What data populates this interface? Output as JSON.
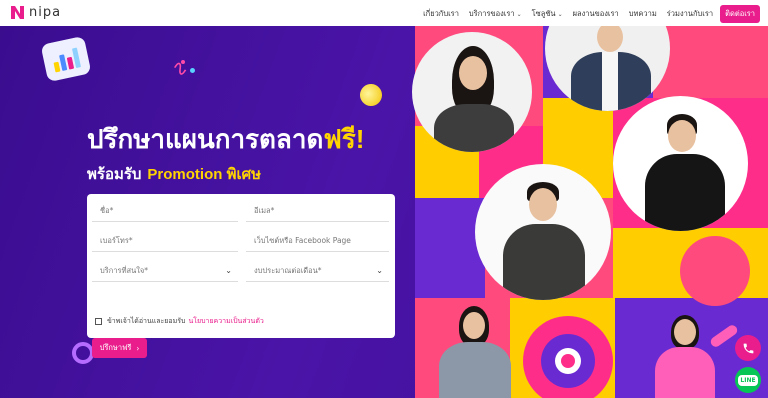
{
  "nav": {
    "logo_text": "nipa",
    "items": [
      {
        "label": "เกี่ยวกับเรา",
        "dropdown": false
      },
      {
        "label": "บริการของเรา",
        "dropdown": true
      },
      {
        "label": "โซลูชัน",
        "dropdown": true
      },
      {
        "label": "ผลงานของเรา",
        "dropdown": false
      },
      {
        "label": "บทความ",
        "dropdown": false
      },
      {
        "label": "ร่วมงานกับเรา",
        "dropdown": false
      }
    ],
    "cta_label": "ติดต่อเรา"
  },
  "hero": {
    "headline_main": "ปรึกษาแผนการตลาด",
    "headline_accent": "ฟรี!",
    "subhead_main": "พร้อมรับ",
    "subhead_accent": "Promotion พิเศษ"
  },
  "form": {
    "name_placeholder": "ชื่อ*",
    "email_placeholder": "อีเมล*",
    "phone_placeholder": "เบอร์โทร*",
    "website_placeholder": "เว็บไซต์หรือ Facebook Page",
    "service_placeholder": "บริการที่สนใจ*",
    "budget_placeholder": "งบประมาณต่อเดือน*",
    "consent_text": "ข้าพเจ้าได้อ่านและยอมรับ",
    "consent_link": "นโยบายความเป็นส่วนตัว",
    "submit_label": "ปรึกษาฟรี"
  },
  "colors": {
    "brand_pink": "#e91e8c",
    "accent_yellow": "#ffd400",
    "hero_purple": "#4a14a8"
  },
  "floating": {
    "phone_icon": "phone-icon",
    "line_icon": "line-icon",
    "line_label": "LINE"
  }
}
